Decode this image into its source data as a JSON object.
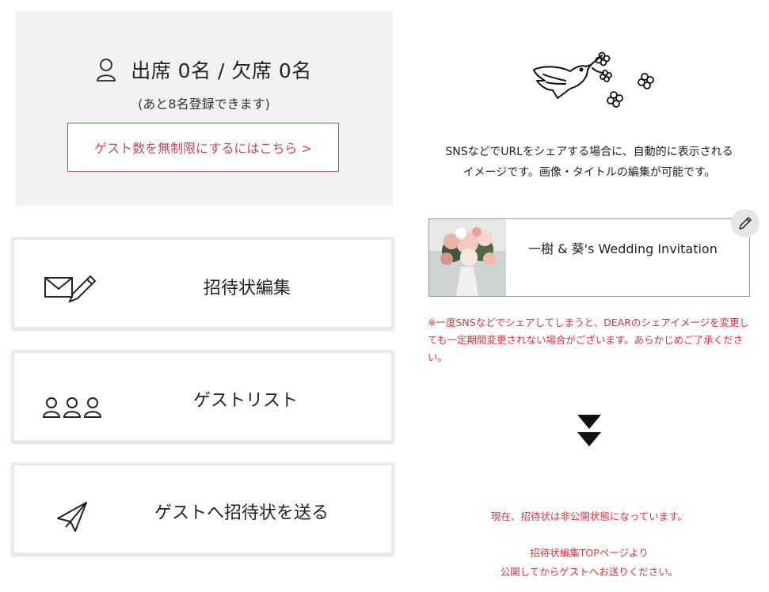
{
  "attendance": {
    "summary": "出席 0名 / 欠席 0名",
    "remaining_note": "(あと8名登録できます)",
    "upgrade_link": "ゲスト数を無制限にするにはこちら >"
  },
  "menu": {
    "edit_invitation": "招待状編集",
    "guest_list": "ゲストリスト",
    "send_invitation": "ゲストへ招待状を送る"
  },
  "share": {
    "description_line1": "SNSなどでURLをシェアする場合に、自動的に表示される",
    "description_line2": "イメージです。画像・タイトルの編集が可能です。",
    "title": "一樹 & 葵's Wedding Invitation",
    "warning": "※一度SNSなどでシェアしてしまうと、DEARのシェアイメージを変更しても一定期間変更されない場合がございます。あらかじめご了承ください。"
  },
  "status": {
    "line1": "現在、招待状は非公開状態になっています。",
    "line2": "招待状編集TOPページより",
    "line3": "公開してからゲストへお送りください。"
  },
  "colors": {
    "accent_red": "#d9363e",
    "button_border": "#c64a5a",
    "panel_bg": "#f2f2f2"
  },
  "icons": [
    "person-icon",
    "envelope-pencil-icon",
    "guests-icon",
    "paper-plane-icon",
    "dove-icon",
    "flower-icon",
    "pencil-icon",
    "double-down-arrow-icon"
  ]
}
